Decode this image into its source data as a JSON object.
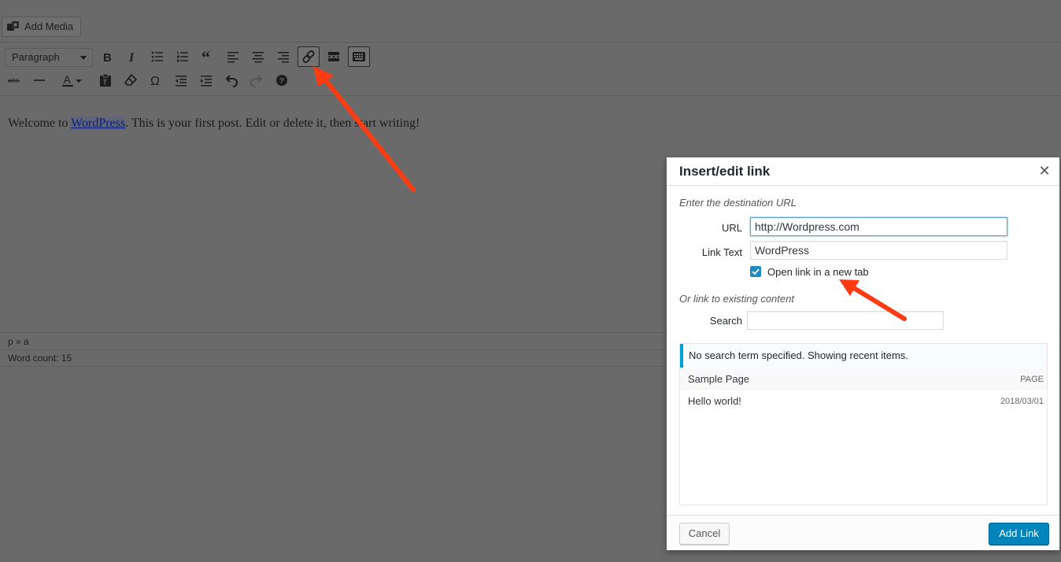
{
  "editor": {
    "add_media_label": "Add Media",
    "format_select_value": "Paragraph",
    "toolbar_row1": [
      "bold-icon",
      "italic-icon",
      "bulleted-list-icon",
      "numbered-list-icon",
      "blockquote-icon",
      "align-left-icon",
      "align-center-icon",
      "align-right-icon",
      "link-icon",
      "read-more-icon",
      "toolbar-toggle-icon"
    ],
    "toolbar_row2": [
      "strikethrough-icon",
      "horizontal-line-icon",
      "text-color-icon",
      "paste-as-text-icon",
      "clear-formatting-icon",
      "special-character-icon",
      "outdent-icon",
      "indent-icon",
      "undo-icon",
      "redo-icon",
      "help-icon"
    ],
    "content_before": "Welcome to ",
    "content_link": "WordPress",
    "content_after": ". This is your first post. Edit or delete it, then start writing!",
    "status_path": "p » a",
    "word_count": "Word count: 15"
  },
  "dialog": {
    "title": "Insert/edit link",
    "destination_heading": "Enter the destination URL",
    "url_label": "URL",
    "url_value": "http://Wordpress.com",
    "link_text_label": "Link Text",
    "link_text_value": "WordPress",
    "new_tab_label": "Open link in a new tab",
    "new_tab_checked": true,
    "existing_heading": "Or link to existing content",
    "search_label": "Search",
    "search_value": "",
    "notice": "No search term specified. Showing recent items.",
    "results": [
      {
        "title": "Sample Page",
        "meta": "PAGE"
      },
      {
        "title": "Hello world!",
        "meta": "2018/03/01"
      }
    ],
    "cancel_label": "Cancel",
    "add_label": "Add Link"
  },
  "colors": {
    "accent": "#0085ba",
    "annotation_arrow": "#ff3b12"
  }
}
